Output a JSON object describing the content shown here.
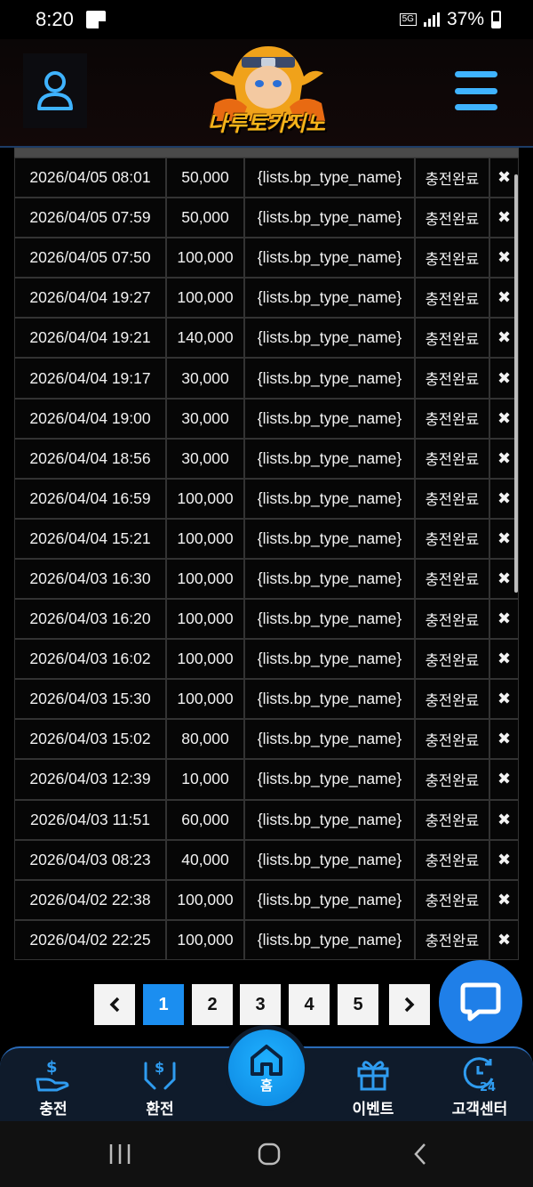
{
  "status_bar": {
    "time": "8:20",
    "network": "5G",
    "battery": "37%"
  },
  "header": {
    "logo_text": "나루토카지노",
    "user_icon": "user-icon",
    "menu_icon": "hamburger-icon"
  },
  "table": {
    "rows": [
      {
        "date": "2026/04/05 08:01",
        "amount": "50,000",
        "type": "{lists.bp_type_name}",
        "status": "충전완료",
        "action": "✖"
      },
      {
        "date": "2026/04/05 07:59",
        "amount": "50,000",
        "type": "{lists.bp_type_name}",
        "status": "충전완료",
        "action": "✖"
      },
      {
        "date": "2026/04/05 07:50",
        "amount": "100,000",
        "type": "{lists.bp_type_name}",
        "status": "충전완료",
        "action": "✖"
      },
      {
        "date": "2026/04/04 19:27",
        "amount": "100,000",
        "type": "{lists.bp_type_name}",
        "status": "충전완료",
        "action": "✖"
      },
      {
        "date": "2026/04/04 19:21",
        "amount": "140,000",
        "type": "{lists.bp_type_name}",
        "status": "충전완료",
        "action": "✖"
      },
      {
        "date": "2026/04/04 19:17",
        "amount": "30,000",
        "type": "{lists.bp_type_name}",
        "status": "충전완료",
        "action": "✖"
      },
      {
        "date": "2026/04/04 19:00",
        "amount": "30,000",
        "type": "{lists.bp_type_name}",
        "status": "충전완료",
        "action": "✖"
      },
      {
        "date": "2026/04/04 18:56",
        "amount": "30,000",
        "type": "{lists.bp_type_name}",
        "status": "충전완료",
        "action": "✖"
      },
      {
        "date": "2026/04/04 16:59",
        "amount": "100,000",
        "type": "{lists.bp_type_name}",
        "status": "충전완료",
        "action": "✖"
      },
      {
        "date": "2026/04/04 15:21",
        "amount": "100,000",
        "type": "{lists.bp_type_name}",
        "status": "충전완료",
        "action": "✖"
      },
      {
        "date": "2026/04/03 16:30",
        "amount": "100,000",
        "type": "{lists.bp_type_name}",
        "status": "충전완료",
        "action": "✖"
      },
      {
        "date": "2026/04/03 16:20",
        "amount": "100,000",
        "type": "{lists.bp_type_name}",
        "status": "충전완료",
        "action": "✖"
      },
      {
        "date": "2026/04/03 16:02",
        "amount": "100,000",
        "type": "{lists.bp_type_name}",
        "status": "충전완료",
        "action": "✖"
      },
      {
        "date": "2026/04/03 15:30",
        "amount": "100,000",
        "type": "{lists.bp_type_name}",
        "status": "충전완료",
        "action": "✖"
      },
      {
        "date": "2026/04/03 15:02",
        "amount": "80,000",
        "type": "{lists.bp_type_name}",
        "status": "충전완료",
        "action": "✖"
      },
      {
        "date": "2026/04/03 12:39",
        "amount": "10,000",
        "type": "{lists.bp_type_name}",
        "status": "충전완료",
        "action": "✖"
      },
      {
        "date": "2026/04/03 11:51",
        "amount": "60,000",
        "type": "{lists.bp_type_name}",
        "status": "충전완료",
        "action": "✖"
      },
      {
        "date": "2026/04/03 08:23",
        "amount": "40,000",
        "type": "{lists.bp_type_name}",
        "status": "충전완료",
        "action": "✖"
      },
      {
        "date": "2026/04/02 22:38",
        "amount": "100,000",
        "type": "{lists.bp_type_name}",
        "status": "충전완료",
        "action": "✖"
      },
      {
        "date": "2026/04/02 22:25",
        "amount": "100,000",
        "type": "{lists.bp_type_name}",
        "status": "충전완료",
        "action": "✖"
      }
    ]
  },
  "pagination": {
    "prev": "‹",
    "pages": [
      "1",
      "2",
      "3",
      "4",
      "5"
    ],
    "current": "1",
    "next": "›"
  },
  "chat_icon": "chat-bubble-icon",
  "bottom_nav": {
    "items": [
      {
        "label": "충전",
        "icon": "deposit-hand-icon"
      },
      {
        "label": "환전",
        "icon": "exchange-hands-icon"
      },
      {
        "label": "홈",
        "icon": "home-icon"
      },
      {
        "label": "이벤트",
        "icon": "gift-icon"
      },
      {
        "label": "고객센터",
        "icon": "support-24-icon"
      }
    ]
  },
  "colors": {
    "accent": "#1b8ef0",
    "nav_bg": "#0f1b2b",
    "logo": "#f5b41a"
  }
}
